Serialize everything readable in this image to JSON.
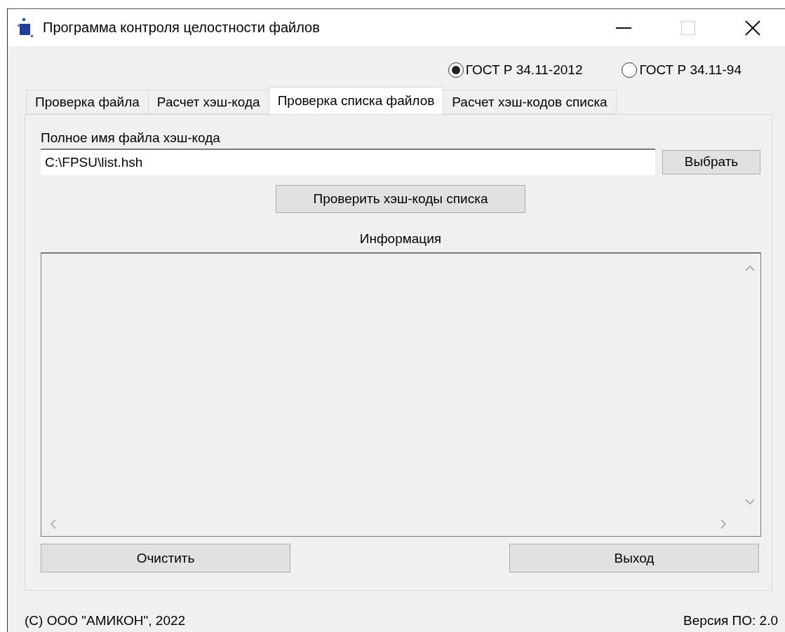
{
  "window": {
    "title": "Программа контроля целостности файлов"
  },
  "algorithms": [
    {
      "label": "ГОСТ Р 34.11-2012",
      "selected": true
    },
    {
      "label": "ГОСТ Р 34.11-94",
      "selected": false
    }
  ],
  "tabs": [
    {
      "label": "Проверка файла",
      "selected": false
    },
    {
      "label": "Расчет хэш-кода",
      "selected": false
    },
    {
      "label": "Проверка списка файлов",
      "selected": true
    },
    {
      "label": "Расчет хэш-кодов списка",
      "selected": false
    }
  ],
  "file_field": {
    "label": "Полное имя файла хэш-кода",
    "value": "C:\\FPSU\\list.hsh"
  },
  "browse_button": "Выбрать",
  "check_button": "Проверить хэш-коды списка",
  "info": {
    "label": "Информация"
  },
  "bottom_buttons": [
    "Очистить",
    "Выход"
  ],
  "status_bar": {
    "copyright": "(С) ООО \"АМИКОН\", 2022",
    "version": "Версия ПО: 2.0"
  }
}
